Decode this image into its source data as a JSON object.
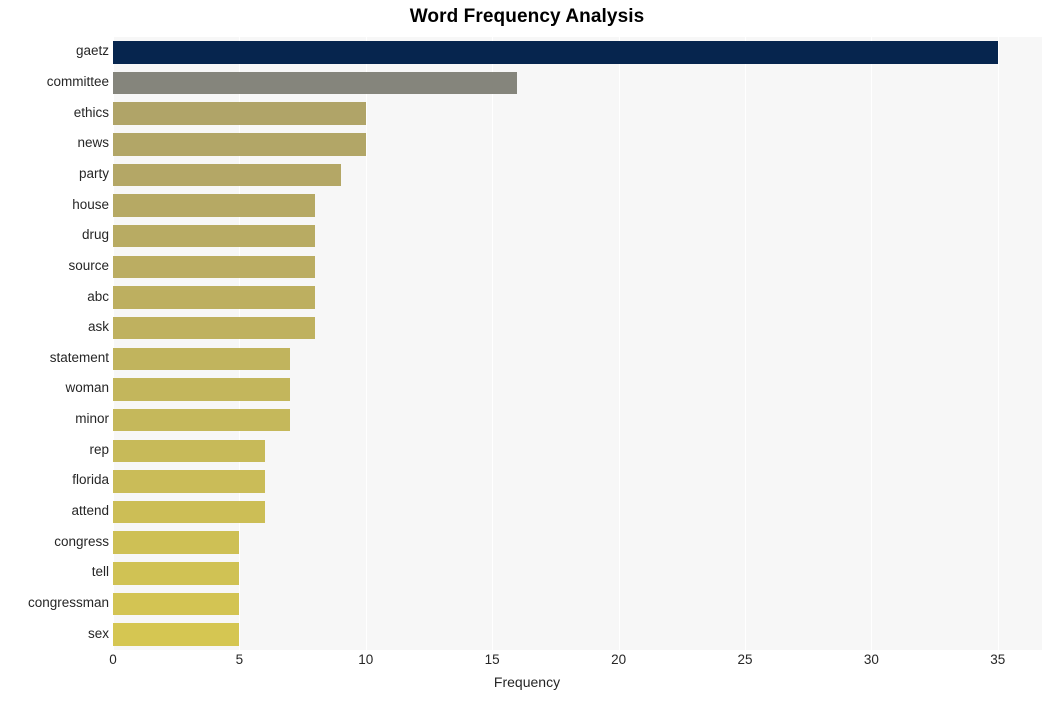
{
  "chart_data": {
    "type": "bar",
    "orientation": "horizontal",
    "title": "Word Frequency Analysis",
    "xlabel": "Frequency",
    "ylabel": "",
    "xlim": [
      0,
      36.75
    ],
    "xticks": [
      0,
      5,
      10,
      15,
      20,
      25,
      30,
      35
    ],
    "xtick_labels": [
      "0",
      "5",
      "10",
      "15",
      "20",
      "25",
      "30",
      "35"
    ],
    "grid": "vertical-white",
    "legend": "none",
    "categories": [
      "gaetz",
      "committee",
      "ethics",
      "news",
      "party",
      "house",
      "drug",
      "source",
      "abc",
      "ask",
      "statement",
      "woman",
      "minor",
      "rep",
      "florida",
      "attend",
      "congress",
      "tell",
      "congressman",
      "sex"
    ],
    "values": [
      35,
      16,
      10,
      10,
      9,
      8,
      8,
      8,
      8,
      8,
      7,
      7,
      7,
      6,
      6,
      6,
      5,
      5,
      5,
      5
    ],
    "bar_colors": [
      "#06254e",
      "#85857c",
      "#b0a468",
      "#b2a667",
      "#b4a766",
      "#b6a964",
      "#b8ab63",
      "#bbad62",
      "#bdaf60",
      "#bfb15f",
      "#c1b45d",
      "#c3b65c",
      "#c5b85b",
      "#c7ba59",
      "#cabc58",
      "#ccbe56",
      "#cec055",
      "#d0c254",
      "#d3c453",
      "#d5c652"
    ],
    "plot_background": "#f7f7f7",
    "figure_background": "#ffffff",
    "gridline_color": "#ffffff",
    "text_color": "#262626",
    "title_color": "#000000"
  }
}
